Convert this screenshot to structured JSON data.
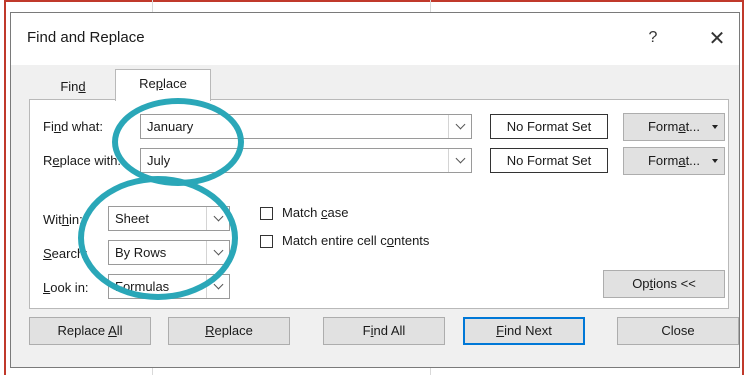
{
  "dialog": {
    "title": "Find and Replace",
    "help_label": "?",
    "close_label": "✕"
  },
  "tabs": {
    "find": {
      "pre": "Fin",
      "key": "d",
      "post": ""
    },
    "replace": {
      "pre": "Re",
      "key": "p",
      "post": "lace"
    }
  },
  "find_what": {
    "label_pre": "Fi",
    "label_key": "n",
    "label_post": "d what:",
    "value": "January",
    "format_status": "No Format Set"
  },
  "replace_with": {
    "label_pre": "R",
    "label_key": "e",
    "label_post": "place with:",
    "value": "July",
    "format_status": "No Format Set"
  },
  "format_button": {
    "pre": "Form",
    "key": "a",
    "post": "t..."
  },
  "within": {
    "label_pre": "Wit",
    "label_key": "h",
    "label_post": "in:",
    "value": "Sheet"
  },
  "search": {
    "label_pre": "",
    "label_key": "S",
    "label_post": "earch:",
    "value": "By Rows"
  },
  "look_in": {
    "label_pre": "",
    "label_key": "L",
    "label_post": "ook in:",
    "value": "Formulas"
  },
  "match_case": {
    "pre": "Match ",
    "key": "c",
    "post": "ase"
  },
  "match_entire": {
    "pre": "Match entire cell c",
    "key": "o",
    "post": "ntents"
  },
  "options_button": {
    "pre": "Op",
    "key": "t",
    "post": "ions <<"
  },
  "footer": {
    "replace_all": {
      "pre": "Replace ",
      "key": "A",
      "post": "ll"
    },
    "replace": {
      "pre": "",
      "key": "R",
      "post": "eplace"
    },
    "find_all": {
      "pre": "F",
      "key": "i",
      "post": "nd All"
    },
    "find_next": {
      "pre": "",
      "key": "F",
      "post": "ind Next"
    },
    "close": "Close"
  },
  "colors": {
    "annotation": "#2aa7b8",
    "primary_border": "#0078d7",
    "sheet_border": "#c0392b"
  }
}
